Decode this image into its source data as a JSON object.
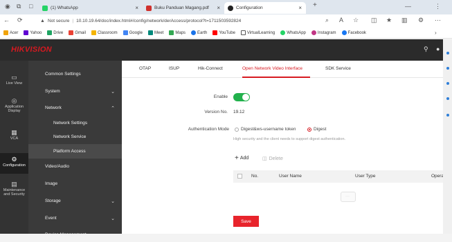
{
  "browser": {
    "tabs": [
      {
        "label": "(1) WhatsApp",
        "favicon_color": "#25d366"
      },
      {
        "label": "Buku Panduan Magang.pdf",
        "favicon_color": "#d0312d"
      },
      {
        "label": "Configuration",
        "favicon_color": "#222222"
      }
    ],
    "new_tab_glyph": "+",
    "window_glyph": "ә",
    "address": {
      "security_label": "Not secure",
      "url": "10.10.19.64/doc/index.html#/config/network/derAccess/protocol?t=1711503592824"
    },
    "bookmarks": [
      {
        "label": "Acer",
        "color": "#f0a30a"
      },
      {
        "label": "Yahoo",
        "color": "#6001d2"
      },
      {
        "label": "Drive",
        "color": "#1fa463"
      },
      {
        "label": "Gmail",
        "color": "#ea4335"
      },
      {
        "label": "Classroom",
        "color": "#f4b400"
      },
      {
        "label": "Google",
        "color": "#4285f4"
      },
      {
        "label": "Meet",
        "color": "#00897b"
      },
      {
        "label": "Maps",
        "color": "#34a853"
      },
      {
        "label": "Earth",
        "color": "#1a73e8"
      },
      {
        "label": "YouTube",
        "color": "#ff0000"
      },
      {
        "label": "VirtualLearning",
        "color": "#555555"
      },
      {
        "label": "WhatsApp",
        "color": "#25d366"
      },
      {
        "label": "Instagram",
        "color": "#c13584"
      },
      {
        "label": "Facebook",
        "color": "#1877f2"
      }
    ]
  },
  "app": {
    "logo": "HIKVISION",
    "brand_color": "#d71920",
    "rail": [
      {
        "label": "Live View",
        "icon": "monitor-icon"
      },
      {
        "label": "Application Display",
        "icon": "app-display-icon"
      },
      {
        "label": "VCA",
        "icon": "vca-icon"
      },
      {
        "label": "Configuration",
        "icon": "gear-icon"
      },
      {
        "label": "Maintenance and Security",
        "icon": "maintenance-icon"
      }
    ],
    "menu": [
      {
        "label": "Common Settings"
      },
      {
        "label": "System"
      },
      {
        "label": "Network"
      },
      {
        "label": "Network Settings"
      },
      {
        "label": "Network Service"
      },
      {
        "label": "Platform Access"
      },
      {
        "label": "Video/Audio"
      },
      {
        "label": "Image"
      },
      {
        "label": "Storage"
      },
      {
        "label": "Event"
      },
      {
        "label": "Device Management"
      }
    ],
    "content": {
      "tabs": [
        "OTAP",
        "ISUP",
        "Hik-Connect",
        "Open Network Video Interface",
        "SDK Service"
      ],
      "enable_label": "Enable",
      "enabled": true,
      "version_label": "Version No.",
      "version_value": "19.12",
      "auth_label": "Authentication Mode",
      "auth_options": [
        "Digest&ws-username token",
        "Digest"
      ],
      "auth_selected": "Digest",
      "auth_hint": "High security and the client needs to support digest authentication.",
      "add_label": "Add",
      "delete_label": "Delete",
      "table_headers": [
        "No.",
        "User Name",
        "User Type",
        "Opera"
      ],
      "save_label": "Save"
    }
  }
}
